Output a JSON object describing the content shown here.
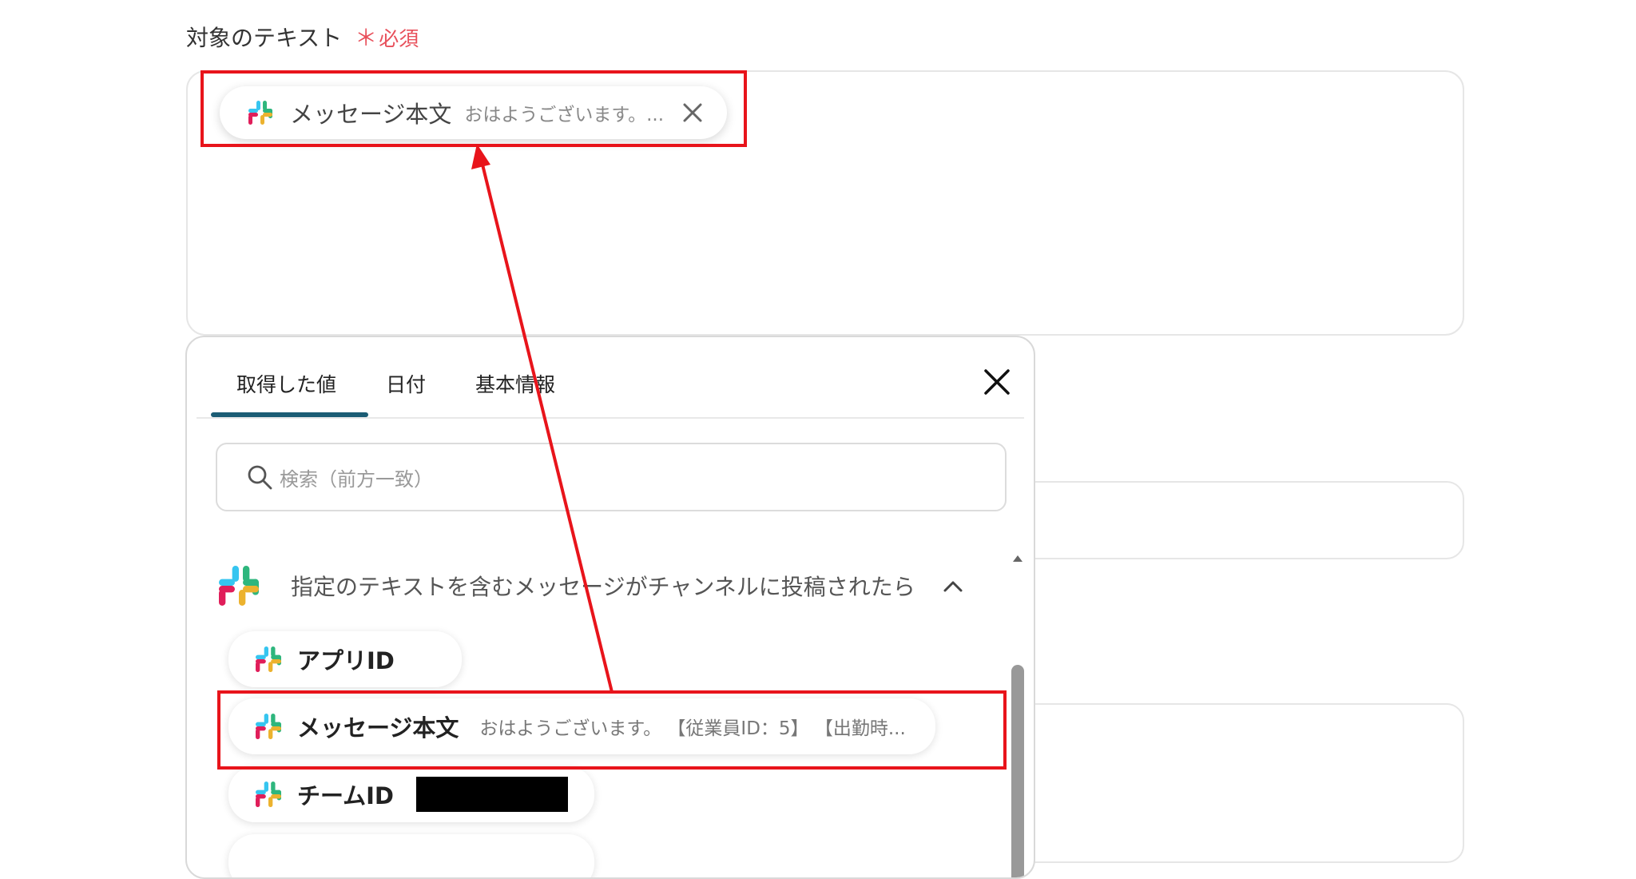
{
  "field": {
    "label": "対象のテキスト",
    "required_star": "＊",
    "required_label": "必須"
  },
  "selected_chip": {
    "icon": "slack-icon",
    "title": "メッセージ本文",
    "value": "おはようございます。..."
  },
  "picker": {
    "tabs": [
      {
        "label": "取得した値",
        "active": true
      },
      {
        "label": "日付",
        "active": false
      },
      {
        "label": "基本情報",
        "active": false
      }
    ],
    "search_placeholder": "検索（前方一致）",
    "group": {
      "icon": "slack-icon",
      "title": "指定のテキストを含むメッセージがチャンネルに投稿されたら"
    },
    "items": [
      {
        "icon": "slack-icon",
        "title": "アプリID",
        "value": ""
      },
      {
        "icon": "slack-icon",
        "title": "メッセージ本文",
        "value": "おはようございます。 【従業員ID：5】 【出勤時..."
      },
      {
        "icon": "slack-icon",
        "title": "チームID",
        "value": ""
      }
    ]
  },
  "colors": {
    "accent": "#1b5c74",
    "required": "#e8505b",
    "highlight": "#e8141b"
  }
}
